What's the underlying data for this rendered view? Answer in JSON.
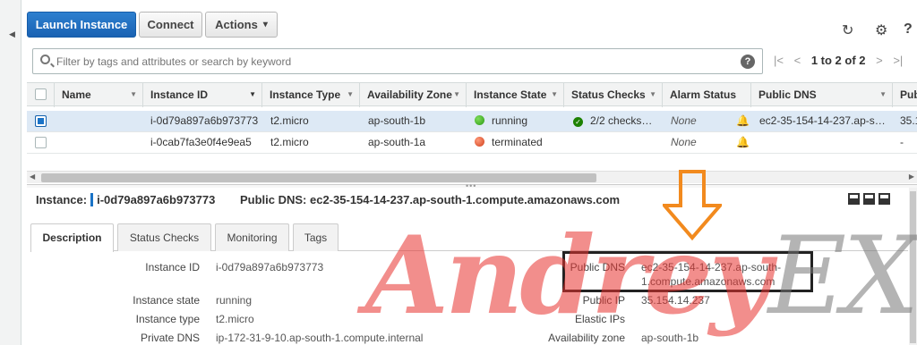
{
  "toolbar": {
    "launch_label": "Launch Instance",
    "connect_label": "Connect",
    "actions_label": "Actions",
    "actions_caret": "▾",
    "refresh_icon": "refresh-icon",
    "settings_icon": "gear-icon",
    "help_icon": "help-icon"
  },
  "filter": {
    "placeholder": "Filter by tags and attributes or search by keyword",
    "help": "?",
    "pager_first": "|<",
    "pager_prev": "<",
    "range": "1 to 2 of 2",
    "pager_next": ">",
    "pager_last": ">|"
  },
  "columns": [
    "Name",
    "Instance ID",
    "Instance Type",
    "Availability Zone",
    "Instance State",
    "Status Checks",
    "Alarm Status",
    "Public DNS",
    "Pub"
  ],
  "rows": [
    {
      "selected": true,
      "name": "",
      "instance_id": "i-0d79a897a6b973773",
      "type": "t2.micro",
      "zone": "ap-south-1b",
      "state": "running",
      "state_color": "#2a9a14",
      "checks": "2/2 checks…",
      "alarm": "None",
      "dns": "ec2-35-154-14-237.ap-s…",
      "public_ip": "35.1"
    },
    {
      "selected": false,
      "name": "",
      "instance_id": "i-0cab7fa3e0f4e9ea5",
      "type": "t2.micro",
      "zone": "ap-south-1a",
      "state": "terminated",
      "state_color": "#d0401c",
      "checks": "",
      "alarm": "None",
      "dns": "",
      "public_ip": "-"
    }
  ],
  "detail": {
    "instance_label": "Instance:",
    "instance_id": "i-0d79a897a6b973773",
    "dns_label": "Public DNS:",
    "dns": "ec2-35-154-14-237.ap-south-1.compute.amazonaws.com",
    "tabs": [
      "Description",
      "Status Checks",
      "Monitoring",
      "Tags"
    ],
    "active_tab": "Description",
    "left": [
      {
        "label": "Instance ID",
        "value": "i-0d79a897a6b973773"
      },
      {
        "label": "Instance state",
        "value": "running"
      },
      {
        "label": "Instance type",
        "value": "t2.micro"
      },
      {
        "label": "Private DNS",
        "value": "ip-172-31-9-10.ap-south-1.compute.internal"
      }
    ],
    "right": [
      {
        "label": "Public DNS",
        "value_line1": "ec2-35-154-14-237.ap-south-",
        "value_line2": "1.compute.amazonaws.com"
      },
      {
        "label": "Public IP",
        "value": "35.154.14.237"
      },
      {
        "label": "Elastic IPs",
        "value": ""
      },
      {
        "label": "Availability zone",
        "value": "ap-south-1b"
      }
    ]
  },
  "watermark": {
    "part1": "Andrey",
    "part2": "EX"
  },
  "colors": {
    "primary": "#1a62b3",
    "selected_row": "#dde9f5",
    "arrow": "#f28a1e",
    "watermark_red": "#e8332f"
  }
}
